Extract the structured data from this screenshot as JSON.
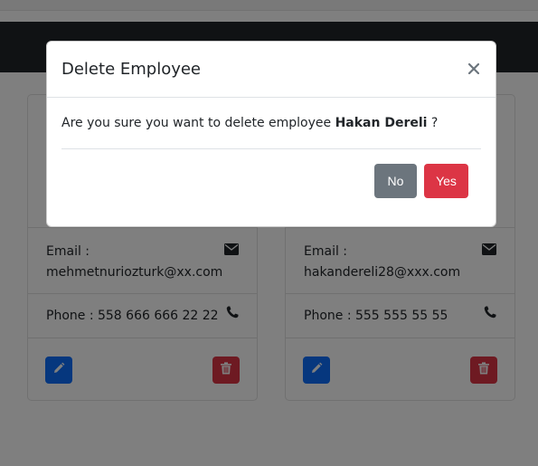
{
  "modal": {
    "title": "Delete Employee",
    "message_prefix": "Are you sure you want to delete employee",
    "employee_name": "Hakan Dereli",
    "message_suffix": "?",
    "no_label": "No",
    "yes_label": "Yes"
  },
  "cards": [
    {
      "email_label": "Email :",
      "email": "mehmetnuriozturk@xx.com",
      "phone": "Phone : 558 666 666 22 22"
    },
    {
      "email_label": "Email :",
      "email": "hakandereli28@xxx.com",
      "phone": "Phone : 555 555 55 55"
    }
  ],
  "colors": {
    "navbar": "#212529",
    "edit_button": "#0d6efd",
    "delete_button": "#dc3545",
    "no_button": "#6c757d",
    "yes_button": "#dc3545"
  },
  "icons": {
    "email": "envelope-icon",
    "phone": "phone-icon",
    "edit": "pencil-icon",
    "delete": "trash-icon",
    "close": "close-icon"
  }
}
